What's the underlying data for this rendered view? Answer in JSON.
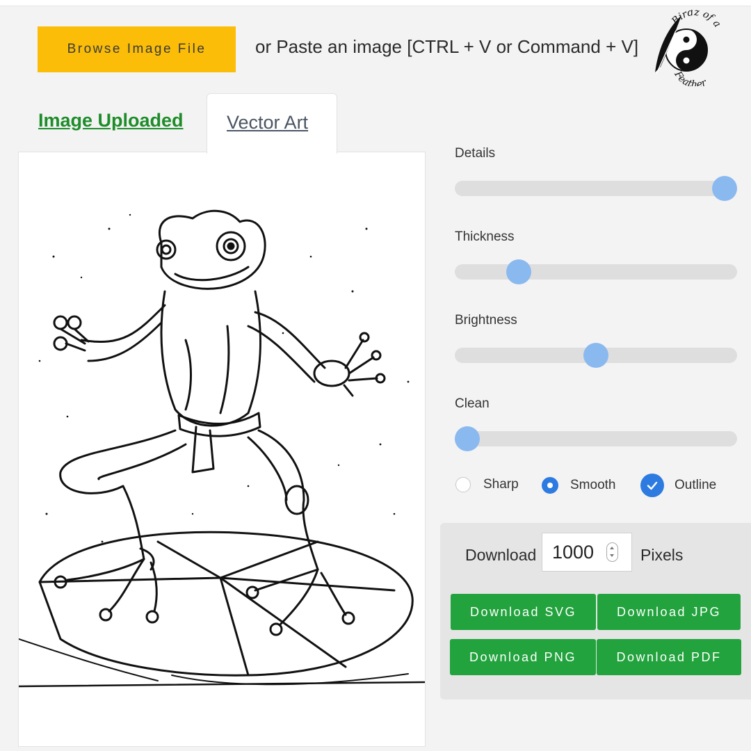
{
  "upload": {
    "browse_label": "Browse Image File",
    "paste_hint": "or Paste an image [CTRL + V or Command + V]"
  },
  "logo": {
    "text": "Birdz of a Feather",
    "icon": "yin-yang-feather-logo"
  },
  "tabs": [
    {
      "label": "Image Uploaded",
      "active": false,
      "color": "#1e8c2a"
    },
    {
      "label": "Vector Art",
      "active": true
    }
  ],
  "preview": {
    "subject": "vector-art-preview",
    "icon": "frog-line-art"
  },
  "sliders": [
    {
      "label": "Details",
      "value": 1.0
    },
    {
      "label": "Thickness",
      "value": 0.2
    },
    {
      "label": "Brightness",
      "value": 0.5
    },
    {
      "label": "Clean",
      "value": 0.0
    }
  ],
  "options": [
    {
      "label": "Sharp",
      "selected": false
    },
    {
      "label": "Smooth",
      "selected": true
    },
    {
      "label": "Outline",
      "checked": true
    }
  ],
  "download": {
    "label": "Download",
    "pixels": "1000",
    "unit_label": "Pixels",
    "buttons": [
      "Download SVG",
      "Download JPG",
      "Download PNG",
      "Download PDF"
    ]
  },
  "colors": {
    "browse_button": "#fbbd08",
    "download_button": "#22a33d",
    "slider_thumb": "#8ab9f0",
    "radio_accent": "#2d7be0"
  }
}
